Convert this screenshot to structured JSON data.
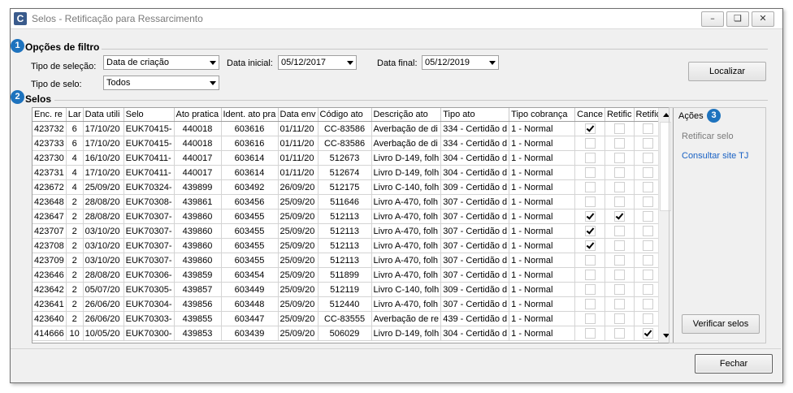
{
  "window": {
    "title": "Selos - Retificação para Ressarcimento",
    "app_icon": "C",
    "controls": [
      "minimize-icon",
      "restore-icon",
      "close-icon"
    ]
  },
  "badges": {
    "one": "1",
    "two": "2",
    "three": "3"
  },
  "filters": {
    "section_title": "Opções de filtro",
    "tipo_selecao_label": "Tipo de seleção:",
    "tipo_selecao_value": "Data de criação",
    "data_inicial_label": "Data inicial:",
    "data_inicial_value": "05/12/2017",
    "data_final_label": "Data final:",
    "data_final_value": "05/12/2019",
    "tipo_selo_label": "Tipo de selo:",
    "tipo_selo_value": "Todos",
    "localizar_label": "Localizar"
  },
  "selos": {
    "section_title": "Selos",
    "columns": [
      "Enc. re",
      "Lar",
      "Data utili",
      "Selo",
      "Ato pratica",
      "Ident. ato pra",
      "Data env",
      "Código ato",
      "Descrição ato",
      "Tipo ato",
      "Tipo cobrança",
      "Cance",
      "Retific",
      "Retific"
    ],
    "rows": [
      [
        "423732",
        "6",
        "17/10/20",
        "EUK70415-",
        "440018",
        "603616",
        "01/11/20",
        "CC-83586",
        "Averbação de di",
        "334 - Certidão d",
        "1 - Normal",
        true,
        false,
        false
      ],
      [
        "423733",
        "6",
        "17/10/20",
        "EUK70415-",
        "440018",
        "603616",
        "01/11/20",
        "CC-83586",
        "Averbação de di",
        "334 - Certidão d",
        "1 - Normal",
        false,
        false,
        false
      ],
      [
        "423730",
        "4",
        "16/10/20",
        "EUK70411-",
        "440017",
        "603614",
        "01/11/20",
        "512673",
        "Livro D-149, folh",
        "304 - Certidão d",
        "1 - Normal",
        false,
        false,
        false
      ],
      [
        "423731",
        "4",
        "17/10/20",
        "EUK70411-",
        "440017",
        "603614",
        "01/11/20",
        "512674",
        "Livro D-149, folh",
        "304 - Certidão d",
        "1 - Normal",
        false,
        false,
        false
      ],
      [
        "423672",
        "4",
        "25/09/20",
        "EUK70324-",
        "439899",
        "603492",
        "26/09/20",
        "512175",
        "Livro C-140, folh",
        "309 - Certidão d",
        "1 - Normal",
        false,
        false,
        false
      ],
      [
        "423648",
        "2",
        "28/08/20",
        "EUK70308-",
        "439861",
        "603456",
        "25/09/20",
        "511646",
        "Livro A-470, folh",
        "307 - Certidão d",
        "1 - Normal",
        false,
        false,
        false
      ],
      [
        "423647",
        "2",
        "28/08/20",
        "EUK70307-",
        "439860",
        "603455",
        "25/09/20",
        "512113",
        "Livro A-470, folh",
        "307 - Certidão d",
        "1 - Normal",
        true,
        true,
        false
      ],
      [
        "423707",
        "2",
        "03/10/20",
        "EUK70307-",
        "439860",
        "603455",
        "25/09/20",
        "512113",
        "Livro A-470, folh",
        "307 - Certidão d",
        "1 - Normal",
        true,
        false,
        false
      ],
      [
        "423708",
        "2",
        "03/10/20",
        "EUK70307-",
        "439860",
        "603455",
        "25/09/20",
        "512113",
        "Livro A-470, folh",
        "307 - Certidão d",
        "1 - Normal",
        true,
        false,
        false
      ],
      [
        "423709",
        "2",
        "03/10/20",
        "EUK70307-",
        "439860",
        "603455",
        "25/09/20",
        "512113",
        "Livro A-470, folh",
        "307 - Certidão d",
        "1 - Normal",
        false,
        false,
        false
      ],
      [
        "423646",
        "2",
        "28/08/20",
        "EUK70306-",
        "439859",
        "603454",
        "25/09/20",
        "511899",
        "Livro A-470, folh",
        "307 - Certidão d",
        "1 - Normal",
        false,
        false,
        false
      ],
      [
        "423642",
        "2",
        "05/07/20",
        "EUK70305-",
        "439857",
        "603449",
        "25/09/20",
        "512119",
        "Livro C-140, folh",
        "309 - Certidão d",
        "1 - Normal",
        false,
        false,
        false
      ],
      [
        "423641",
        "2",
        "26/06/20",
        "EUK70304-",
        "439856",
        "603448",
        "25/09/20",
        "512440",
        "Livro A-470, folh",
        "307 - Certidão d",
        "1 - Normal",
        false,
        false,
        false
      ],
      [
        "423640",
        "2",
        "26/06/20",
        "EUK70303-",
        "439855",
        "603447",
        "25/09/20",
        "CC-83555",
        "Averbação de re",
        "439 - Certidão d",
        "1 - Normal",
        false,
        false,
        false
      ],
      [
        "414666",
        "10",
        "10/05/20",
        "EUK70300-",
        "439853",
        "603439",
        "25/09/20",
        "506029",
        "Livro D-149, folh",
        "304 - Certidão d",
        "1 - Normal",
        false,
        false,
        true
      ]
    ]
  },
  "actions": {
    "title": "Ações",
    "retificar_selo": "Retificar selo",
    "consultar_site": "Consultar site TJ",
    "verificar_selos": "Verificar selos",
    "link_color": "#1a62c4",
    "disabled_color": "#7a7a7a"
  },
  "footer": {
    "fechar_label": "Fechar"
  },
  "colors": {
    "badge": "#1e73be",
    "window_bg": "#f0f0f0"
  }
}
